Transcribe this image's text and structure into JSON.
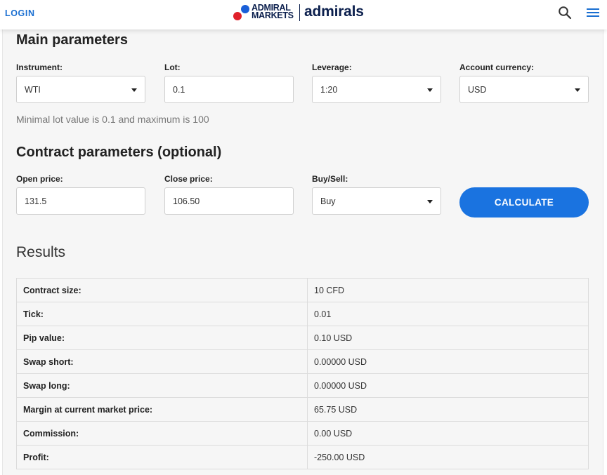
{
  "header": {
    "login_label": "LOGIN",
    "logo_line1": "ADMIRAL",
    "logo_line2": "MARKETS",
    "brand": "admirals",
    "search_icon": "search-icon",
    "menu_icon": "hamburger-menu-icon"
  },
  "main": {
    "title": "Main parameters",
    "instrument": {
      "label": "Instrument:",
      "value": "WTI"
    },
    "lot": {
      "label": "Lot:",
      "value": "0.1"
    },
    "leverage": {
      "label": "Leverage:",
      "value": "1:20"
    },
    "currency": {
      "label": "Account currency:",
      "value": "USD"
    },
    "hint": "Minimal lot value is 0.1 and maximum is 100"
  },
  "contract": {
    "title": "Contract parameters (optional)",
    "open_price": {
      "label": "Open price:",
      "value": "131.5"
    },
    "close_price": {
      "label": "Close price:",
      "value": "106.50"
    },
    "buy_sell": {
      "label": "Buy/Sell:",
      "value": "Buy"
    },
    "calculate_label": "CALCULATE"
  },
  "results": {
    "title": "Results",
    "rows": [
      {
        "key": "Contract size:",
        "value": "10 CFD"
      },
      {
        "key": "Tick:",
        "value": "0.01"
      },
      {
        "key": "Pip value:",
        "value": "0.10 USD"
      },
      {
        "key": "Swap short:",
        "value": "0.00000 USD"
      },
      {
        "key": "Swap long:",
        "value": "0.00000 USD"
      },
      {
        "key": "Margin at current market price:",
        "value": "65.75 USD"
      },
      {
        "key": "Commission:",
        "value": "0.00 USD"
      },
      {
        "key": "Profit:",
        "value": "-250.00 USD"
      }
    ]
  },
  "colors": {
    "accent": "#1a73e0",
    "brand_navy": "#0b1f4d",
    "brand_red": "#e0202a"
  }
}
